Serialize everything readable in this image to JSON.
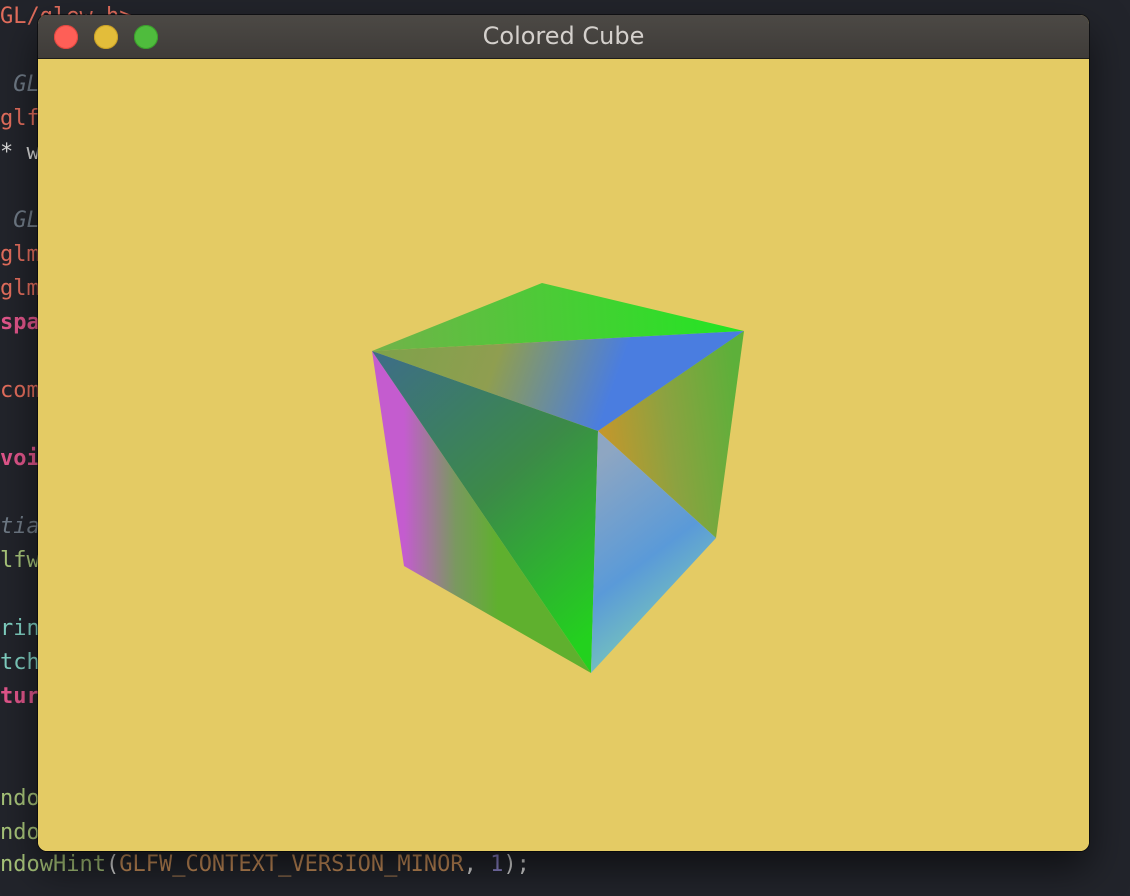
{
  "background_editor": {
    "lines": [
      {
        "text": "GL/glew.h>",
        "style": "c-red"
      },
      {
        "text": "",
        "style": "c-plain"
      },
      {
        "text": " GL",
        "style": "c-comment"
      },
      {
        "text": "glf",
        "style": "c-red"
      },
      {
        "text": "* w",
        "style": "c-white"
      },
      {
        "text": "",
        "style": "c-plain"
      },
      {
        "text": " GL",
        "style": "c-comment"
      },
      {
        "text": "glm",
        "style": "c-red"
      },
      {
        "text": "glm",
        "style": "c-red"
      },
      {
        "text": "spa",
        "style": "c-pink"
      },
      {
        "text": "",
        "style": "c-plain"
      },
      {
        "text": "com",
        "style": "c-red"
      },
      {
        "text": "",
        "style": "c-plain"
      },
      {
        "text": "voi",
        "style": "c-pink"
      },
      {
        "text": "",
        "style": "c-plain"
      },
      {
        "text": "tia",
        "style": "c-comment"
      },
      {
        "text": "lfw",
        "style": "c-green"
      },
      {
        "text": "",
        "style": "c-plain"
      },
      {
        "text": "rin",
        "style": "c-teal"
      },
      {
        "text": "tch",
        "style": "c-teal"
      },
      {
        "text": "tur",
        "style": "c-pink"
      },
      {
        "text": "",
        "style": "c-plain"
      },
      {
        "text": "",
        "style": "c-plain"
      },
      {
        "text": "ndo",
        "style": "c-green"
      },
      {
        "text": "ndo",
        "style": "c-green"
      }
    ],
    "last_line": {
      "func": "ndowHint",
      "open": "(",
      "arg": "GLFW_CONTEXT_VERSION_MINOR",
      "sep": ", ",
      "num": "1",
      "close": ");"
    }
  },
  "window": {
    "title": "Colored Cube",
    "clear_color": "#e4cb64",
    "controls": {
      "close": "close-button",
      "minimize": "minimize-button",
      "zoom": "zoom-button"
    }
  },
  "scene": {
    "object": "colored cube"
  }
}
